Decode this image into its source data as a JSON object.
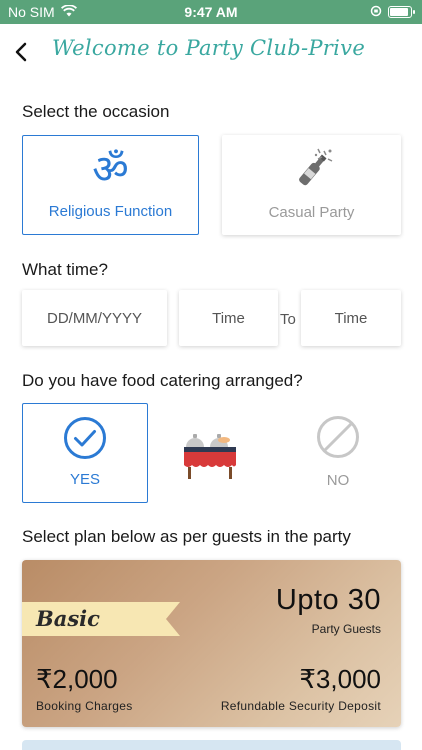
{
  "status": {
    "carrier": "No SIM",
    "time": "9:47 AM"
  },
  "header": {
    "title": "Welcome to Party Club-Prive"
  },
  "occasion": {
    "label": "Select the occasion",
    "options": [
      {
        "label": "Religious Function",
        "selected": true,
        "icon": "om-icon"
      },
      {
        "label": "Casual Party",
        "selected": false,
        "icon": "champagne-icon"
      }
    ]
  },
  "time": {
    "label": "What time?",
    "date_placeholder": "DD/MM/YYYY",
    "from_placeholder": "Time",
    "to_label": "To",
    "to_placeholder": "Time"
  },
  "food": {
    "label": "Do you have food catering arranged?",
    "yes_label": "YES",
    "no_label": "NO",
    "selected": "YES"
  },
  "plans": {
    "label": "Select plan below as per guests in the party",
    "items": [
      {
        "name": "Basic",
        "guests": "Upto 30",
        "guests_label": "Party Guests",
        "booking_price": "₹2,000",
        "booking_label": "Booking Charges",
        "deposit_price": "₹3,000",
        "deposit_label": "Refundable Security Deposit"
      }
    ]
  },
  "colors": {
    "accent": "#2b7ad4",
    "statusbar": "#5aa37a",
    "title": "#3aa8a0"
  }
}
